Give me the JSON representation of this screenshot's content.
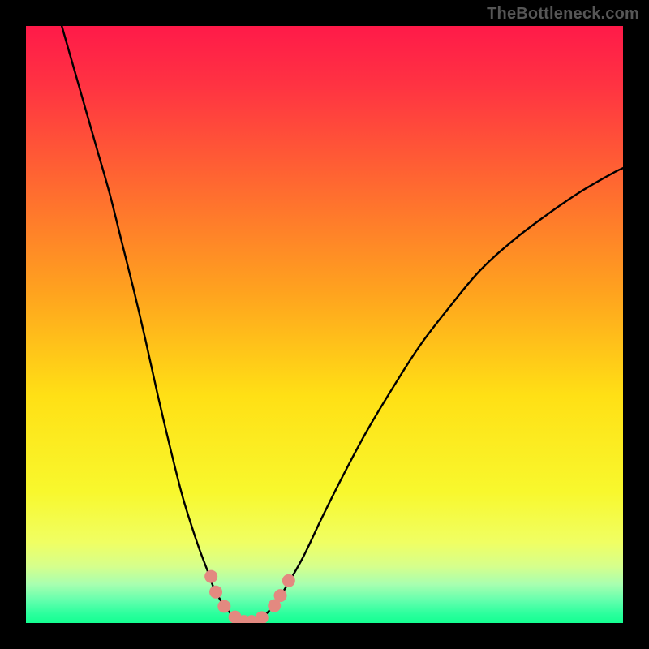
{
  "watermark": "TheBottleneck.com",
  "palette": {
    "black": "#000000",
    "stroke": "#000000",
    "marker_fill": "#e38980",
    "marker_stroke": "#d46a60"
  },
  "chart_data": {
    "type": "line",
    "title": "",
    "xlabel": "",
    "ylabel": "",
    "xlim": [
      0,
      100
    ],
    "ylim": [
      0,
      100
    ],
    "grid": false,
    "background_gradient": {
      "stops": [
        {
          "offset": 0.0,
          "color": "#ff1a49"
        },
        {
          "offset": 0.1,
          "color": "#ff3342"
        },
        {
          "offset": 0.27,
          "color": "#ff6a30"
        },
        {
          "offset": 0.45,
          "color": "#ffa41e"
        },
        {
          "offset": 0.62,
          "color": "#ffe015"
        },
        {
          "offset": 0.78,
          "color": "#f8f82d"
        },
        {
          "offset": 0.865,
          "color": "#f0ff63"
        },
        {
          "offset": 0.905,
          "color": "#d6ff8c"
        },
        {
          "offset": 0.935,
          "color": "#a8ffb0"
        },
        {
          "offset": 0.962,
          "color": "#63ffad"
        },
        {
          "offset": 0.985,
          "color": "#2aff9d"
        },
        {
          "offset": 1.0,
          "color": "#14ff92"
        }
      ]
    },
    "series": [
      {
        "name": "left_curve",
        "x": [
          6,
          8,
          10,
          12,
          14,
          16,
          18,
          20,
          22,
          24,
          26,
          27.5,
          29,
          30.5,
          31.5,
          33,
          34.5,
          36
        ],
        "y": [
          100,
          93,
          86,
          79,
          72,
          64,
          56,
          47.5,
          38.5,
          30,
          22,
          17,
          12.5,
          8.5,
          5.8,
          3.2,
          1.4,
          0.3
        ]
      },
      {
        "name": "right_curve",
        "x": [
          38.5,
          40,
          42,
          44,
          46.5,
          49.5,
          53,
          57,
          61.5,
          66,
          71,
          76,
          81.5,
          87,
          92.5,
          98,
          100
        ],
        "y": [
          0.3,
          1.3,
          3.6,
          6.8,
          11.2,
          17.5,
          24.5,
          32,
          39.5,
          46.5,
          53,
          59,
          64,
          68.2,
          72,
          75.2,
          76.2
        ]
      },
      {
        "name": "floor",
        "x": [
          36,
          37.25,
          38.5
        ],
        "y": [
          0.3,
          0.15,
          0.3
        ]
      }
    ],
    "markers": [
      {
        "x": 31.0,
        "y": 7.8
      },
      {
        "x": 31.8,
        "y": 5.2
      },
      {
        "x": 33.2,
        "y": 2.8
      },
      {
        "x": 35.0,
        "y": 1.0
      },
      {
        "x": 36.5,
        "y": 0.25
      },
      {
        "x": 37.8,
        "y": 0.25
      },
      {
        "x": 39.5,
        "y": 0.9
      },
      {
        "x": 41.6,
        "y": 2.9
      },
      {
        "x": 42.6,
        "y": 4.6
      },
      {
        "x": 44.0,
        "y": 7.1
      }
    ]
  }
}
